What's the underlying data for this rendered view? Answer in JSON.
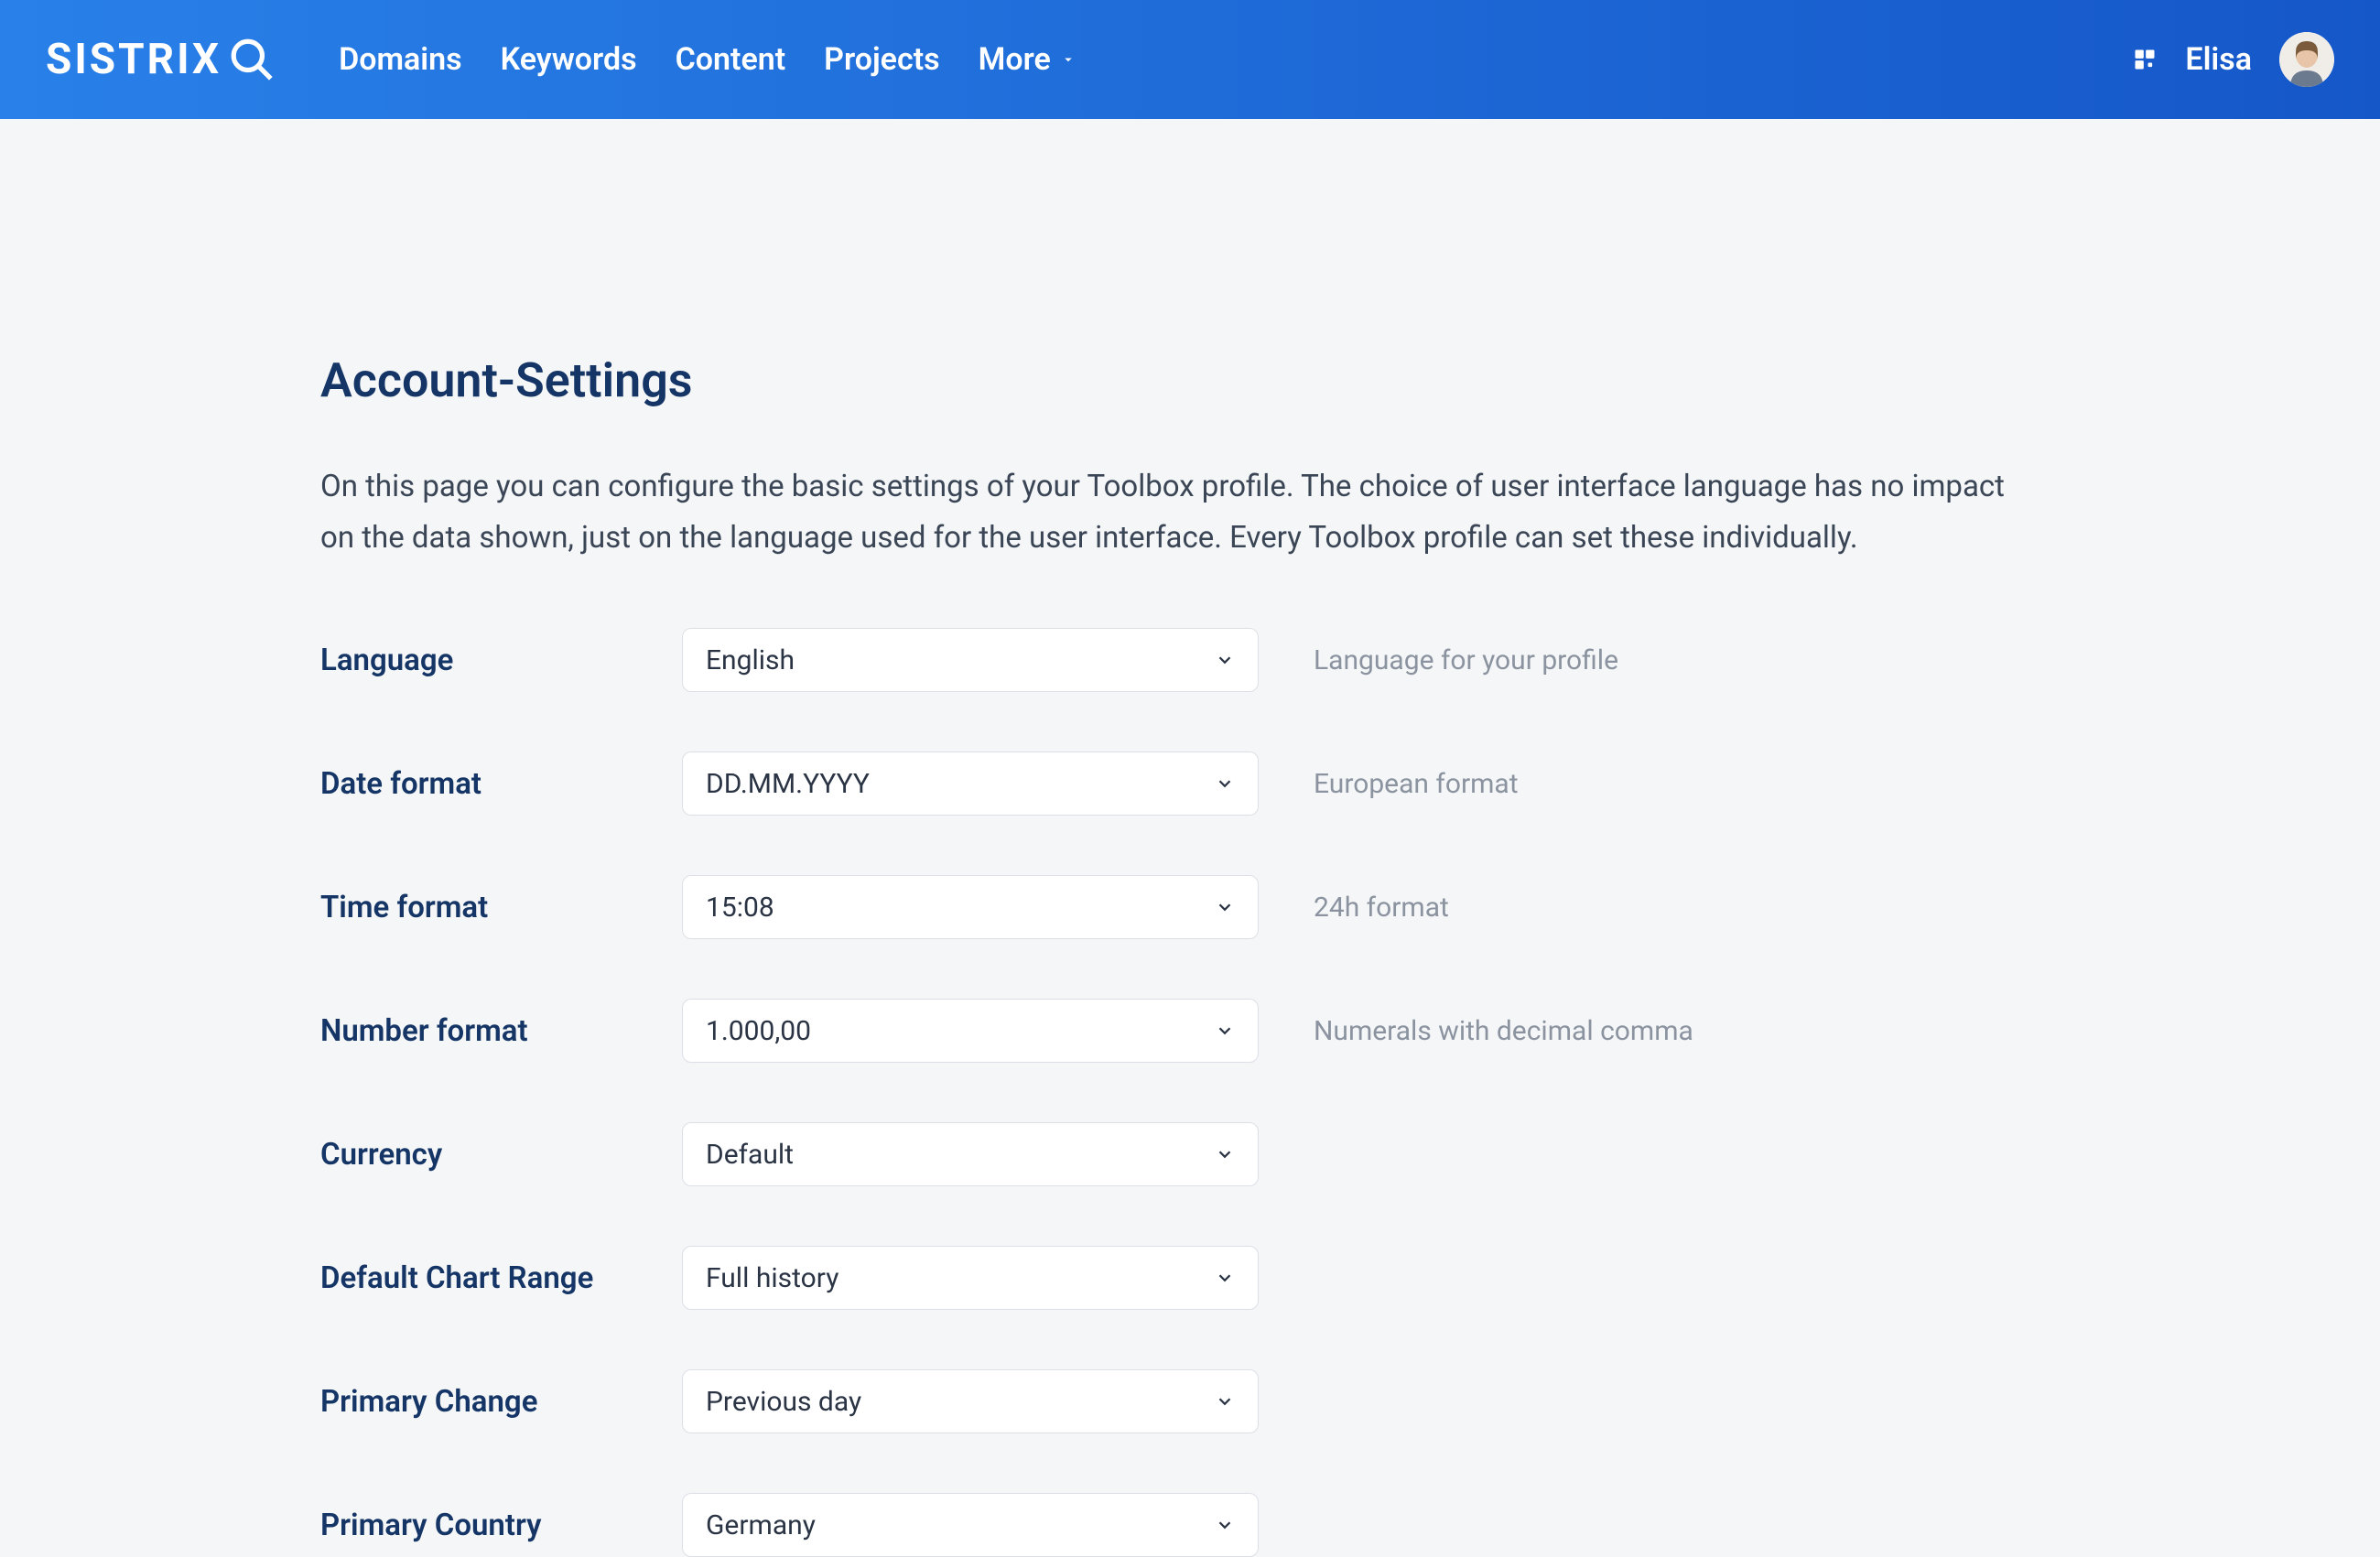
{
  "brand": "SISTRIX",
  "nav": {
    "domains": "Domains",
    "keywords": "Keywords",
    "content": "Content",
    "projects": "Projects",
    "more": "More"
  },
  "user": {
    "name": "Elisa"
  },
  "page": {
    "title": "Account-Settings",
    "description": "On this page you can configure the basic settings of your Toolbox profile. The choice of user interface language has no impact on the data shown, just on the language used for the user interface. Every Toolbox profile can set these individually."
  },
  "settings": {
    "language": {
      "label": "Language",
      "value": "English",
      "hint": "Language for your profile"
    },
    "date_format": {
      "label": "Date format",
      "value": "DD.MM.YYYY",
      "hint": "European format"
    },
    "time_format": {
      "label": "Time format",
      "value": "15:08",
      "hint": "24h format"
    },
    "number_format": {
      "label": "Number format",
      "value": "1.000,00",
      "hint": "Numerals with decimal comma"
    },
    "currency": {
      "label": "Currency",
      "value": "Default",
      "hint": ""
    },
    "chart_range": {
      "label": "Default Chart Range",
      "value": "Full history",
      "hint": ""
    },
    "primary_change": {
      "label": "Primary Change",
      "value": "Previous day",
      "hint": ""
    },
    "primary_country": {
      "label": "Primary Country",
      "value": "Germany",
      "hint": ""
    }
  }
}
